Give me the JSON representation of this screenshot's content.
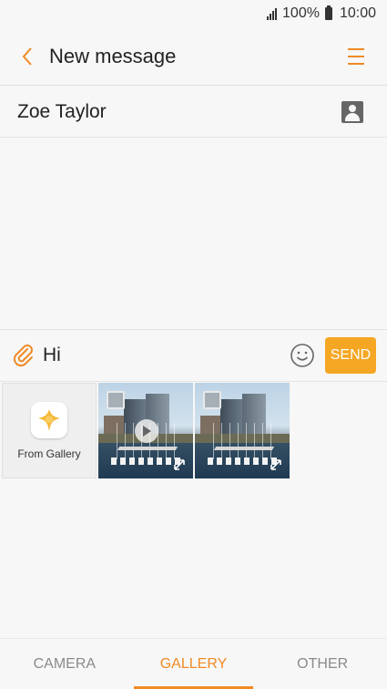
{
  "status_bar": {
    "battery": "100%",
    "time": "10:00"
  },
  "header": {
    "title": "New message",
    "back_icon": "chevron-left-icon",
    "menu_icon": "hamburger-menu-icon"
  },
  "recipient": {
    "name": "Zoe Taylor",
    "icon": "contact-icon"
  },
  "compose": {
    "message": "Hi",
    "send_label": "SEND",
    "attach_icon": "paperclip-icon",
    "emoji_icon": "smiley-icon"
  },
  "gallery": {
    "from_gallery_label": "From Gallery",
    "items": [
      {
        "type": "video"
      },
      {
        "type": "image"
      }
    ]
  },
  "tabs": [
    {
      "label": "CAMERA"
    },
    {
      "label": "GALLERY"
    },
    {
      "label": "OTHER"
    }
  ],
  "colors": {
    "accent": "#f08a24",
    "send_button": "#f5a623"
  }
}
